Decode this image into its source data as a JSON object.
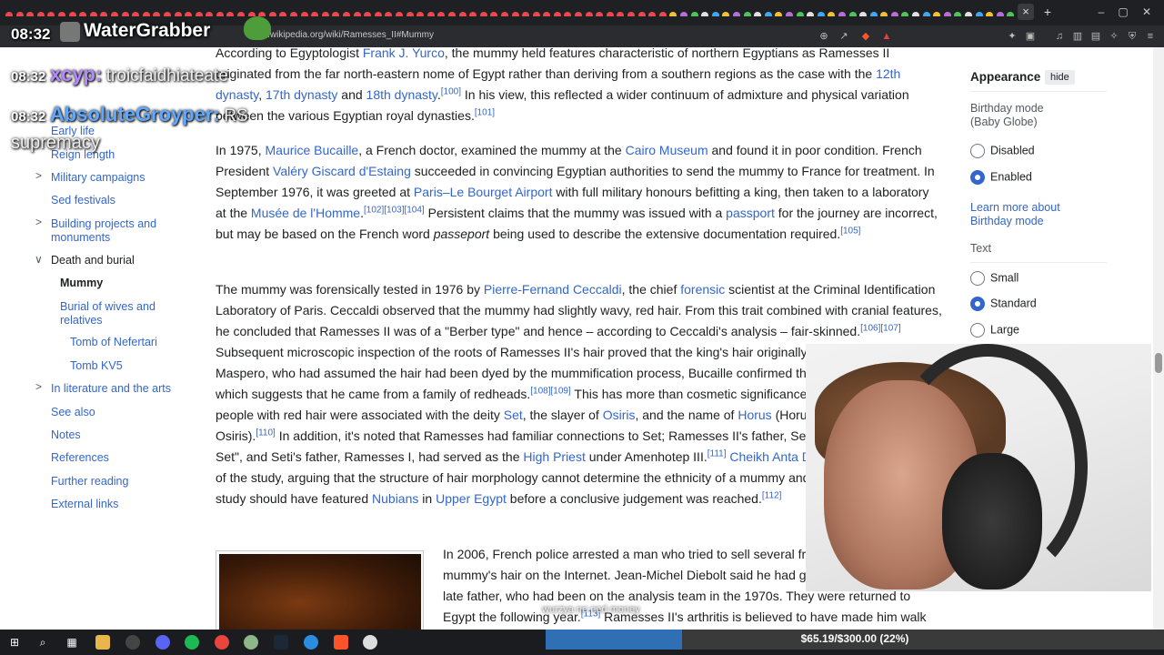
{
  "browser": {
    "url": "en.wikipedia.org/wiki/Ramesses_II#Mummy",
    "tab_close": "×",
    "new_tab": "+",
    "window_min": "–",
    "window_max": "▢",
    "window_close": "✕"
  },
  "overlay": {
    "clock": "08:32",
    "channel_name": "WaterGrabber",
    "chat": [
      {
        "time": "08:32",
        "user": "xcyp:",
        "message": "troicfaidhiateate"
      },
      {
        "time": "08:32",
        "user": "AbsoluteGroyper:",
        "message": "RS"
      },
      {
        "time": "",
        "user": "",
        "message": "supremacy"
      }
    ],
    "toast": "wurzya ne ned money",
    "donation": {
      "text": "$65.19/$300.00 (22%)",
      "progress": 0.22
    }
  },
  "toc": {
    "items": [
      {
        "label": "Early life"
      },
      {
        "label": "Reign length"
      },
      {
        "label": "Military campaigns"
      },
      {
        "label": "Sed festivals"
      },
      {
        "label": "Building projects and monuments"
      },
      {
        "label": "Death and burial"
      },
      {
        "label": "Mummy"
      },
      {
        "label": "Burial of wives and relatives"
      },
      {
        "label": "Tomb of Nefertari"
      },
      {
        "label": "Tomb KV5"
      },
      {
        "label": "In literature and the arts"
      },
      {
        "label": "See also"
      },
      {
        "label": "Notes"
      },
      {
        "label": "References"
      },
      {
        "label": "Further reading"
      },
      {
        "label": "External links"
      }
    ]
  },
  "content": {
    "p1": {
      "t1": "According to Egyptologist ",
      "l1": "Frank J. Yurco",
      "t2": ", the mummy held features characteristic of northern Egyptians as Ramesses II originated from the far north-eastern nome of Egypt rather than deriving from a southern regions as the case with the ",
      "l2": "12th dynasty",
      "t3": ", ",
      "l3": "17th dynasty",
      "t4": " and ",
      "l4": "18th dynasty",
      "r1": "[100]",
      "t5": " In his view, this reflected a wider continuum of admixture and physical variation between the various Egyptian royal dynasties.",
      "r2": "[101]"
    },
    "p2": {
      "t1": "In 1975, ",
      "l1": "Maurice Bucaille",
      "t2": ", a French doctor, examined the mummy at the ",
      "l2": "Cairo Museum",
      "t3": " and found it in poor condition. French President ",
      "l3": "Valéry Giscard d'Estaing",
      "t4": " succeeded in convincing Egyptian authorities to send the mummy to France for treatment. In September 1976, it was greeted at ",
      "l4": "Paris–Le Bourget Airport",
      "t5": " with full military honours befitting a king, then taken to a laboratory at the ",
      "l5": "Musée de l'Homme",
      "r1": "[102][103][104]",
      "t6": " Persistent claims that the mummy was issued with a ",
      "l6": "passport",
      "t7": " for the journey are incorrect, but may be based on the French word ",
      "i1": "passeport",
      "t8": " being used to describe the extensive documentation required.",
      "r2": "[105]"
    },
    "p3": {
      "t1": "The mummy was forensically tested in 1976 by ",
      "l1": "Pierre-Fernand Ceccaldi",
      "t2": ", the chief ",
      "l2": "forensic",
      "t3": " scientist at the Criminal Identification Laboratory of Paris. Ceccaldi observed that the mummy had slightly wavy, red hair. From this trait combined with cranial features, he concluded that Ramesses II was of a \"Berber type\" and hence – according to Ceccaldi's analysis – fair-skinned.",
      "r1": "[106][107]",
      "t4": " Subsequent microscopic inspection of the roots of Ramesses II's hair proved that the king's hair originally was red. Unlike Maspero, who had assumed the hair had been dyed by the mummification process, Bucaille confirmed the red hair was natural, which suggests that he came from a family of redheads.",
      "r2": "[108][109]",
      "t5": " This has more than cosmetic significance: in ancient Egypt people with red hair were associated with the deity ",
      "l3": "Set",
      "t6": ", the slayer of ",
      "l4": "Osiris",
      "t7": ", and the name of ",
      "l5": "Horus",
      "t8": " (Horus being the son of Osiris).",
      "r3": "[110]",
      "t9": " In addition, it's noted that Ramesses had familiar connections to Set; Ramesses II's father, Seti I, means \"follower of Set\", and Seti's father, Ramesses I, had served as the ",
      "l6": "High Priest",
      "t10": " under Amenhotep III.",
      "r4": "[111]",
      "t11": " ",
      "l7": "Cheikh Anta Diop",
      "t12": " disputed the results of the study, arguing that the structure of hair morphology cannot determine the ethnicity of a mummy and that a comparative study should have featured ",
      "l8": "Nubians",
      "t13": " in ",
      "l9": "Upper Egypt",
      "t14": " before a conclusive judgement was reached.",
      "r5": "[112]"
    },
    "p4": {
      "t1": "In 2006, French police arrested a man who tried to sell several fragments of the mummy's hair on the Internet. Jean-Michel Diebolt said he had got the relics from his late father, who had been on the analysis team in the 1970s. They were returned to Egypt the following year.",
      "r1": "[113]",
      "t2": " Ramesses II's arthritis is believed to have made him walk with a hunched"
    }
  },
  "appearance": {
    "title": "Appearance",
    "hide": "hide",
    "birthday_label": "Birthday mode (Baby Globe)",
    "birthday_options": [
      "Disabled",
      "Enabled"
    ],
    "birthday_selected": "Enabled",
    "learn_more": "Learn more about Birthday mode",
    "text_label": "Text",
    "text_options": [
      "Small",
      "Standard",
      "Large"
    ],
    "text_selected": "Standard"
  },
  "colors": {
    "link": "#3366cc",
    "text": "#202122",
    "tabstrip": "#1f2023",
    "donation_fill": "#2f6fb3"
  }
}
